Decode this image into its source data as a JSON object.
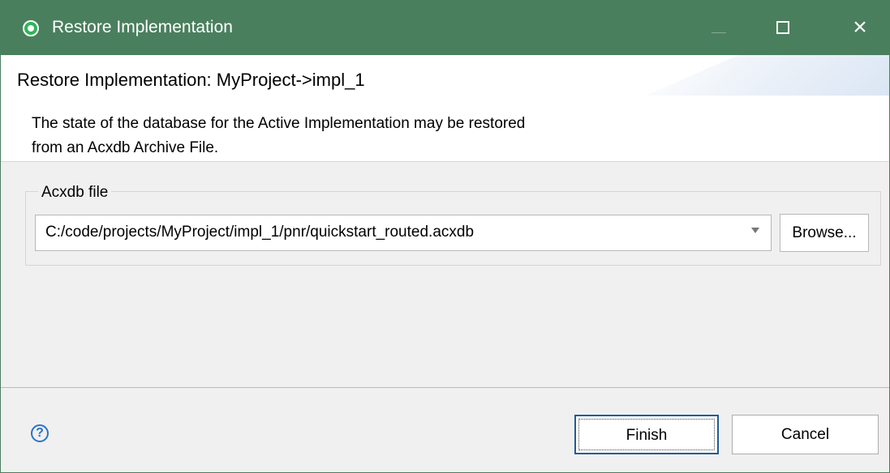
{
  "window": {
    "title": "Restore Implementation"
  },
  "header": {
    "title": "Restore Implementation: MyProject->impl_1",
    "description": "The state of the database for the Active Implementation may be restored from an Acxdb Archive File."
  },
  "acxdb_group": {
    "label": "Acxdb file",
    "selected_file": "C:/code/projects/MyProject/impl_1/pnr/quickstart_routed.acxdb",
    "browse_label": "Browse..."
  },
  "footer": {
    "finish_label": "Finish",
    "cancel_label": "Cancel"
  },
  "colors": {
    "titlebar": "#4a7f5e",
    "accent_blue": "#1f5b96",
    "help_blue": "#2a74c8"
  },
  "icons": {
    "app": "app-icon",
    "help": "help-icon",
    "dropdown": "chevron-down-icon",
    "maximize": "maximize-icon",
    "close": "close-icon"
  }
}
